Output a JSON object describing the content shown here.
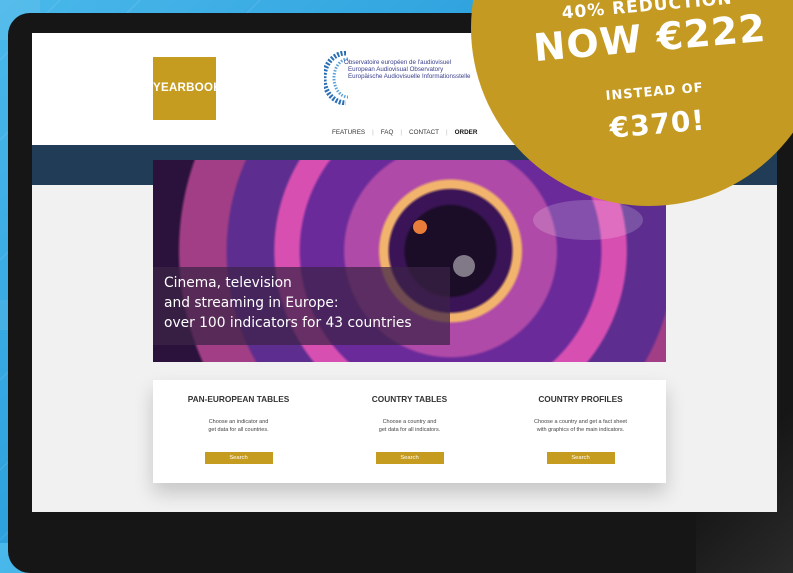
{
  "logo": {
    "label": "YEARBOOK"
  },
  "observatory": {
    "lines": [
      "Observatoire européen de l'audiovisuel",
      "European Audiovisual Observatory",
      "Europäische Audiovisuelle Informationsstelle"
    ]
  },
  "nav": {
    "items": [
      "FEATURES",
      "FAQ",
      "CONTACT",
      "ORDER"
    ]
  },
  "hero": {
    "caption_lines": [
      "Cinema, television",
      "and streaming in Europe:",
      "over 100 indicators for 43 countries"
    ]
  },
  "cards": [
    {
      "title": "PAN-EUROPEAN TABLES",
      "desc_lines": [
        "Choose an indicator and",
        "get data for all countries."
      ],
      "button": "Search"
    },
    {
      "title": "COUNTRY TABLES",
      "desc_lines": [
        "Choose a country and",
        "get data for all indicators."
      ],
      "button": "Search"
    },
    {
      "title": "COUNTRY PROFILES",
      "desc_lines": [
        "Choose a country and get a fact sheet",
        "with graphics of the main indicators."
      ],
      "button": "Search"
    }
  ],
  "promo": {
    "reduction": "40% REDUCTION",
    "price": "NOW €222",
    "instead_label": "INSTEAD OF",
    "old_price": "€370!"
  },
  "colors": {
    "background": "#2a9fdc",
    "gold": "#c59b20",
    "band": "#203c57",
    "bezel": "#161616"
  }
}
